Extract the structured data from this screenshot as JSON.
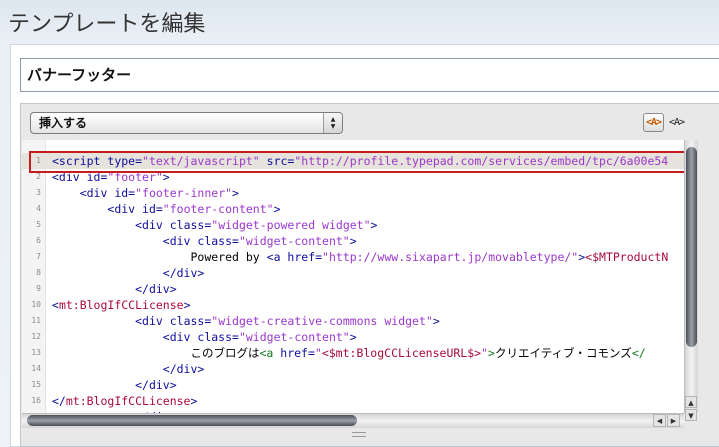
{
  "page": {
    "title": "テンプレートを編集"
  },
  "template": {
    "name": "バナーフッター"
  },
  "toolbar": {
    "insert_label": "挿入する",
    "mode_rich_label": "<A>",
    "mode_source_label": "<A>"
  },
  "editor": {
    "lines": [
      {
        "n": "1",
        "segs": [
          {
            "c": "t",
            "t": "<script "
          },
          {
            "c": "a",
            "t": "type="
          },
          {
            "c": "s",
            "t": "\"text/javascript\""
          },
          {
            "c": "a",
            "t": " src="
          },
          {
            "c": "s",
            "t": "\"http://profile.typepad.com/services/embed/tpc/6a00e54"
          }
        ]
      },
      {
        "n": "2",
        "segs": [
          {
            "c": "t",
            "t": "<div "
          },
          {
            "c": "a",
            "t": "id="
          },
          {
            "c": "s",
            "t": "\"footer\""
          },
          {
            "c": "t",
            "t": ">"
          }
        ]
      },
      {
        "n": "3",
        "segs": [
          {
            "c": "tx",
            "t": "    "
          },
          {
            "c": "t",
            "t": "<div "
          },
          {
            "c": "a",
            "t": "id="
          },
          {
            "c": "s",
            "t": "\"footer-inner\""
          },
          {
            "c": "t",
            "t": ">"
          }
        ]
      },
      {
        "n": "4",
        "segs": [
          {
            "c": "tx",
            "t": "        "
          },
          {
            "c": "t",
            "t": "<div "
          },
          {
            "c": "a",
            "t": "id="
          },
          {
            "c": "s",
            "t": "\"footer-content\""
          },
          {
            "c": "t",
            "t": ">"
          }
        ]
      },
      {
        "n": "5",
        "segs": [
          {
            "c": "tx",
            "t": "            "
          },
          {
            "c": "t",
            "t": "<div "
          },
          {
            "c": "a",
            "t": "class="
          },
          {
            "c": "s",
            "t": "\"widget-powered widget\""
          },
          {
            "c": "t",
            "t": ">"
          }
        ]
      },
      {
        "n": "6",
        "segs": [
          {
            "c": "tx",
            "t": "                "
          },
          {
            "c": "t",
            "t": "<div "
          },
          {
            "c": "a",
            "t": "class="
          },
          {
            "c": "s",
            "t": "\"widget-content\""
          },
          {
            "c": "t",
            "t": ">"
          }
        ]
      },
      {
        "n": "7",
        "segs": [
          {
            "c": "tx",
            "t": "                    Powered by "
          },
          {
            "c": "t",
            "t": "<a "
          },
          {
            "c": "a",
            "t": "href="
          },
          {
            "c": "s",
            "t": "\"http://www.sixapart.jp/movabletype/\""
          },
          {
            "c": "t",
            "t": ">"
          },
          {
            "c": "mt",
            "t": "<$MTProductN"
          }
        ]
      },
      {
        "n": "8",
        "segs": [
          {
            "c": "tx",
            "t": "                "
          },
          {
            "c": "t",
            "t": "</div>"
          }
        ]
      },
      {
        "n": "9",
        "segs": [
          {
            "c": "tx",
            "t": "            "
          },
          {
            "c": "t",
            "t": "</div>"
          }
        ]
      },
      {
        "n": "10",
        "segs": [
          {
            "c": "t",
            "t": "<"
          },
          {
            "c": "mt",
            "t": "mt:BlogIfCCLicense"
          },
          {
            "c": "t",
            "t": ">"
          }
        ]
      },
      {
        "n": "11",
        "segs": [
          {
            "c": "tx",
            "t": "            "
          },
          {
            "c": "t",
            "t": "<div "
          },
          {
            "c": "a",
            "t": "class="
          },
          {
            "c": "s",
            "t": "\"widget-creative-commons widget\""
          },
          {
            "c": "t",
            "t": ">"
          }
        ]
      },
      {
        "n": "12",
        "segs": [
          {
            "c": "tx",
            "t": "                "
          },
          {
            "c": "t",
            "t": "<div "
          },
          {
            "c": "a",
            "t": "class="
          },
          {
            "c": "s",
            "t": "\"widget-content\""
          },
          {
            "c": "t",
            "t": ">"
          }
        ]
      },
      {
        "n": "13",
        "segs": [
          {
            "c": "tx",
            "t": "                    このブログは"
          },
          {
            "c": "g",
            "t": "<a "
          },
          {
            "c": "a",
            "t": "href="
          },
          {
            "c": "s",
            "t": "\""
          },
          {
            "c": "mt",
            "t": "<$mt:BlogCCLicenseURL$>"
          },
          {
            "c": "s",
            "t": "\""
          },
          {
            "c": "g",
            "t": ">"
          },
          {
            "c": "tx",
            "t": "クリエイティブ・コモンズ"
          },
          {
            "c": "g",
            "t": "</"
          }
        ]
      },
      {
        "n": "14",
        "segs": [
          {
            "c": "tx",
            "t": "                "
          },
          {
            "c": "t",
            "t": "</div>"
          }
        ]
      },
      {
        "n": "15",
        "segs": [
          {
            "c": "tx",
            "t": "            "
          },
          {
            "c": "t",
            "t": "</div>"
          }
        ]
      },
      {
        "n": "16",
        "segs": [
          {
            "c": "t",
            "t": "</"
          },
          {
            "c": "mt",
            "t": "mt:BlogIfCCLicense"
          },
          {
            "c": "t",
            "t": ">"
          }
        ]
      },
      {
        "n": "17",
        "segs": [
          {
            "c": "tx",
            "t": "            "
          },
          {
            "c": "t",
            "t": "</div>"
          }
        ]
      }
    ]
  },
  "icons": {
    "select_arrow": "up-down-arrows-icon",
    "scroll_up": "up-arrow-icon",
    "scroll_down": "down-arrow-icon",
    "scroll_left": "left-arrow-icon",
    "scroll_right": "right-arrow-icon"
  },
  "colors": {
    "tag": "#0f0e9a",
    "string": "#9c38c8",
    "mt_tag": "#a80b3a",
    "anchor": "#0f7a1d",
    "highlight_border": "#c51d1d"
  }
}
